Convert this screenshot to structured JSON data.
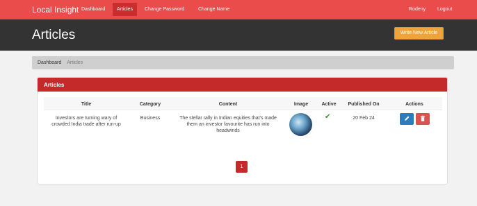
{
  "nav": {
    "brand": "Local Insight",
    "links": [
      "Dashboard",
      "Articles",
      "Change Password",
      "Change Name"
    ],
    "right": [
      "Rodeny",
      "Logout"
    ]
  },
  "header": {
    "title": "Articles",
    "write_button": "Write New Article"
  },
  "breadcrumb": {
    "home": "Dashboard",
    "current": "Articles"
  },
  "panel": {
    "heading": "Articles"
  },
  "table": {
    "headers": [
      "Title",
      "Category",
      "Content",
      "Image",
      "Active",
      "Published On",
      "Actions"
    ],
    "rows": [
      {
        "title_line1": "Investors are turning wary of",
        "title_line2": "crowded India trade after run-up",
        "category": "Business",
        "content_line1": "The stellar rally in Indian equities that's made",
        "content_line2": "them an investor favourite has run into",
        "content_line3": "headwinds",
        "active": "✔",
        "published": "20 Feb 24"
      }
    ]
  },
  "pagination": {
    "current_page": "1"
  },
  "colors": {
    "nav_bg": "#ea4b4b",
    "header_bg": "#333333",
    "panel_heading": "#c42a2a",
    "write_button": "#f0a33a",
    "edit_button": "#2d7bbf",
    "delete_button": "#d9534f"
  },
  "icons": {
    "edit": "pencil-icon",
    "delete": "trash-icon",
    "active": "check-icon"
  }
}
